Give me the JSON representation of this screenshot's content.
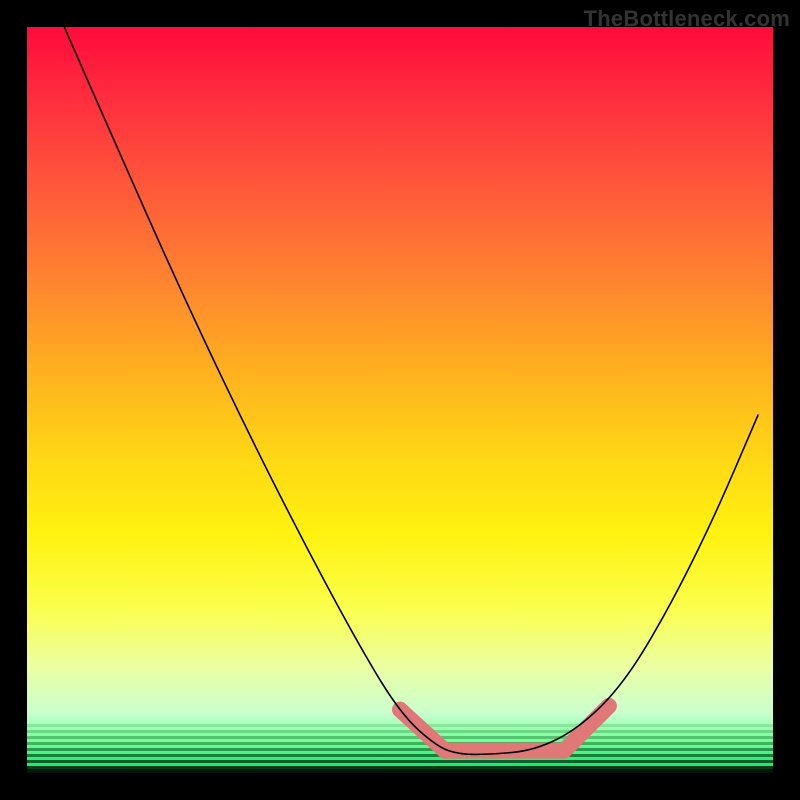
{
  "watermark": "TheBottleneck.com",
  "chart_data": {
    "type": "line",
    "title": "",
    "xlabel": "",
    "ylabel": "",
    "xlim": [
      0,
      1
    ],
    "ylim": [
      0,
      1
    ],
    "grid": false,
    "series": [
      {
        "name": "curve",
        "x": [
          0.05,
          0.12,
          0.2,
          0.28,
          0.36,
          0.44,
          0.5,
          0.55,
          0.58,
          0.62,
          0.68,
          0.74,
          0.8,
          0.86,
          0.92,
          0.98
        ],
        "y": [
          1.0,
          0.84,
          0.66,
          0.49,
          0.33,
          0.18,
          0.08,
          0.035,
          0.025,
          0.025,
          0.03,
          0.06,
          0.12,
          0.22,
          0.34,
          0.48
        ]
      }
    ],
    "highlight_segments": [
      {
        "x0": 0.5,
        "y0": 0.085,
        "x1": 0.56,
        "y1": 0.03
      },
      {
        "x0": 0.56,
        "y0": 0.03,
        "x1": 0.72,
        "y1": 0.03
      },
      {
        "x0": 0.72,
        "y0": 0.03,
        "x1": 0.78,
        "y1": 0.09
      }
    ],
    "gradient_stops": [
      {
        "pos": 0.0,
        "color": "#ff0b3b"
      },
      {
        "pos": 0.1,
        "color": "#ff2f3e"
      },
      {
        "pos": 0.22,
        "color": "#ff5a3a"
      },
      {
        "pos": 0.34,
        "color": "#ff8430"
      },
      {
        "pos": 0.46,
        "color": "#ffb01f"
      },
      {
        "pos": 0.58,
        "color": "#ffd815"
      },
      {
        "pos": 0.68,
        "color": "#fff210"
      },
      {
        "pos": 0.78,
        "color": "#fbff4d"
      },
      {
        "pos": 0.86,
        "color": "#eaffa4"
      },
      {
        "pos": 0.92,
        "color": "#c9ffcf"
      },
      {
        "pos": 0.96,
        "color": "#69ff95"
      },
      {
        "pos": 1.0,
        "color": "#00e063"
      }
    ]
  }
}
